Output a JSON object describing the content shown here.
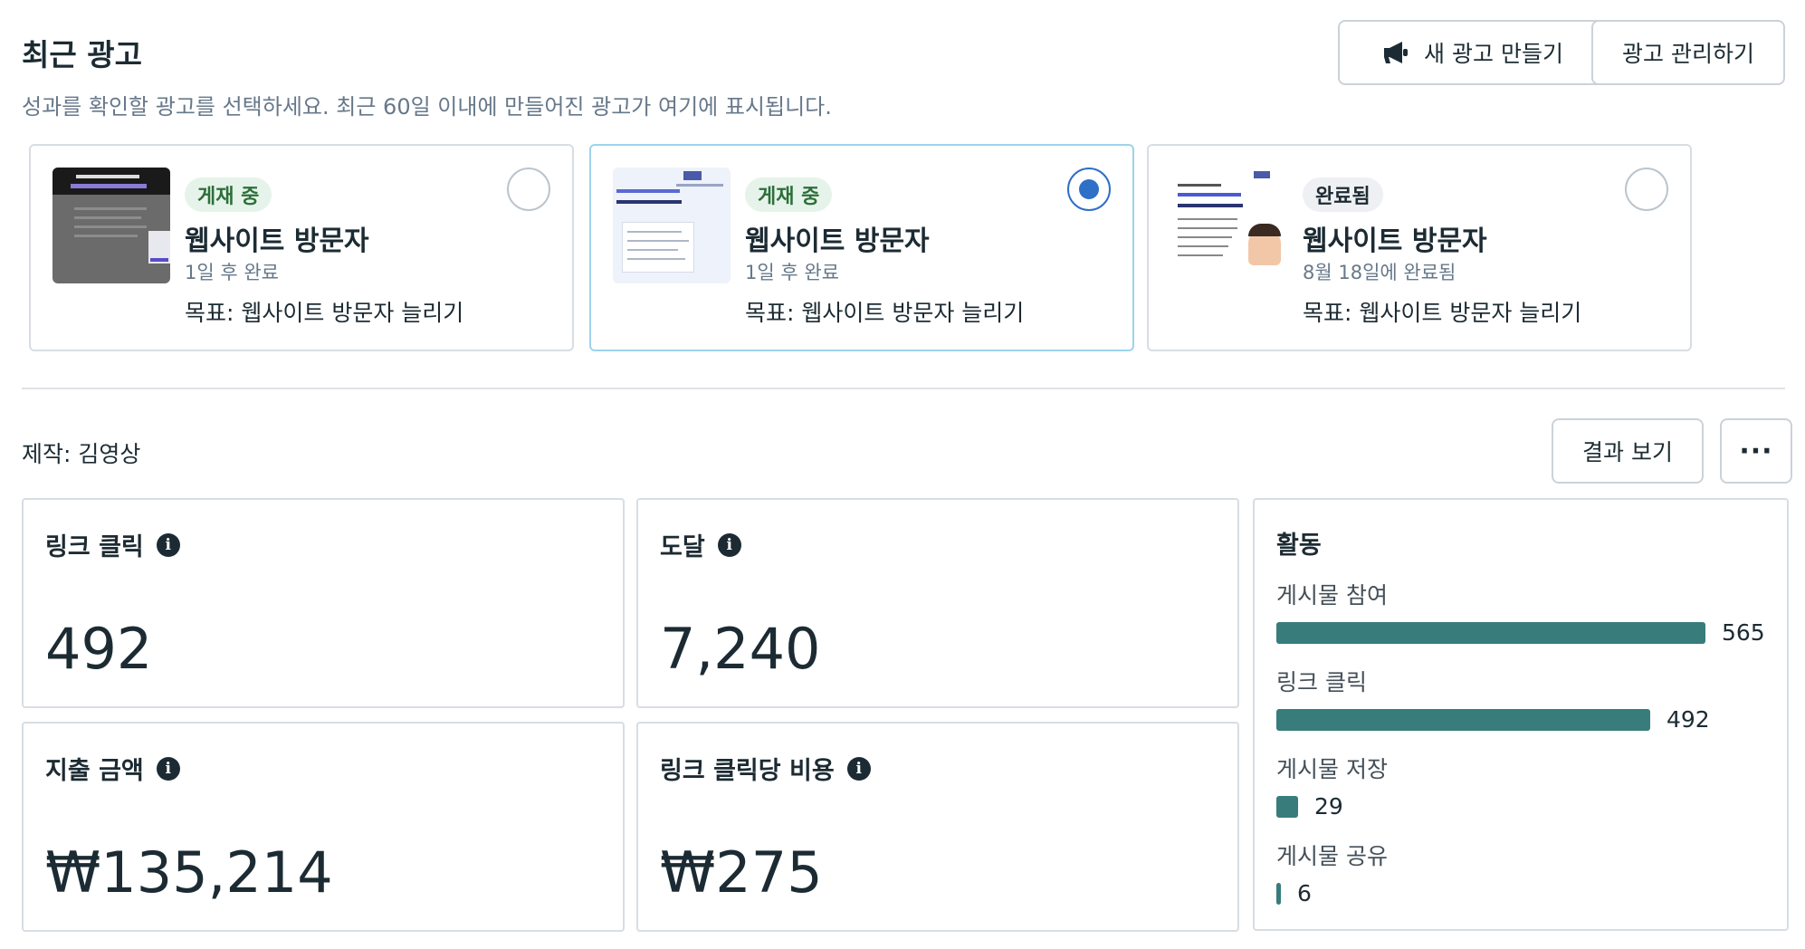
{
  "header": {
    "title": "최근 광고",
    "subtitle": "성과를 확인할 광고를 선택하세요. 최근 60일 이내에 만들어진 광고가 여기에 표시됩니다.",
    "new_ad_label": "새 광고 만들기",
    "manage_label": "광고 관리하기",
    "new_ad_icon": "megaphone-icon"
  },
  "ads": [
    {
      "status": "게재 중",
      "title": "웹사이트 방문자",
      "sub": "1일 후 완료",
      "goal": "목표: 웹사이트 방문자 늘리기",
      "selected": false
    },
    {
      "status": "게재 중",
      "title": "웹사이트 방문자",
      "sub": "1일 후 완료",
      "goal": "목표: 웹사이트 방문자 늘리기",
      "selected": true
    },
    {
      "status": "완료됨",
      "title": "웹사이트 방문자",
      "sub": "8월 18일에 완료됨",
      "goal": "목표: 웹사이트 방문자 늘리기",
      "selected": false
    }
  ],
  "creator": "제작: 김영상",
  "results_label": "결과 보기",
  "more_label": "···",
  "metrics": {
    "link_clicks": {
      "label": "링크 클릭",
      "value": "492"
    },
    "reach": {
      "label": "도달",
      "value": "7,240"
    },
    "spend": {
      "label": "지출 금액",
      "value": "₩135,214"
    },
    "cpc": {
      "label": "링크 클릭당 비용",
      "value": "₩275"
    }
  },
  "activity": {
    "title": "활동",
    "items": [
      {
        "label": "게시물 참여",
        "value": 565
      },
      {
        "label": "링크 클릭",
        "value": 492
      },
      {
        "label": "게시물 저장",
        "value": 29
      },
      {
        "label": "게시물 공유",
        "value": 6
      }
    ],
    "bar_color": "#387c7c"
  },
  "colors": {
    "accent": "#2e6fc7",
    "live_badge_bg": "#e6f3ea",
    "live_badge_text": "#2c6f3a"
  }
}
